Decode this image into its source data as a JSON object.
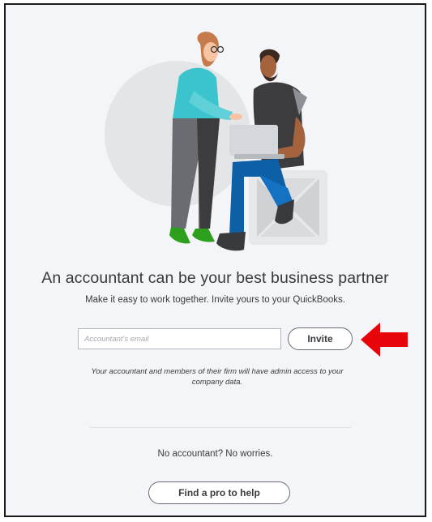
{
  "hero": {
    "illustration_icon": "accountant-collaboration-illustration"
  },
  "main": {
    "headline": "An accountant can be your best business partner",
    "subtitle": "Make it easy to work together. Invite yours to your QuickBooks.",
    "email_placeholder": "Accountant's email",
    "email_value": "",
    "invite_label": "Invite",
    "note": "Your accountant and members of their firm will have admin access to your company data."
  },
  "footer": {
    "no_accountant_text": "No accountant? No worries.",
    "find_pro_label": "Find a pro to help"
  },
  "annotation": {
    "arrow_icon": "left-pointing-red-arrow",
    "arrow_color": "#e8040b"
  },
  "colors": {
    "background": "#f4f5f8",
    "text": "#393a3d",
    "frame_border": "#1b1b1b"
  }
}
